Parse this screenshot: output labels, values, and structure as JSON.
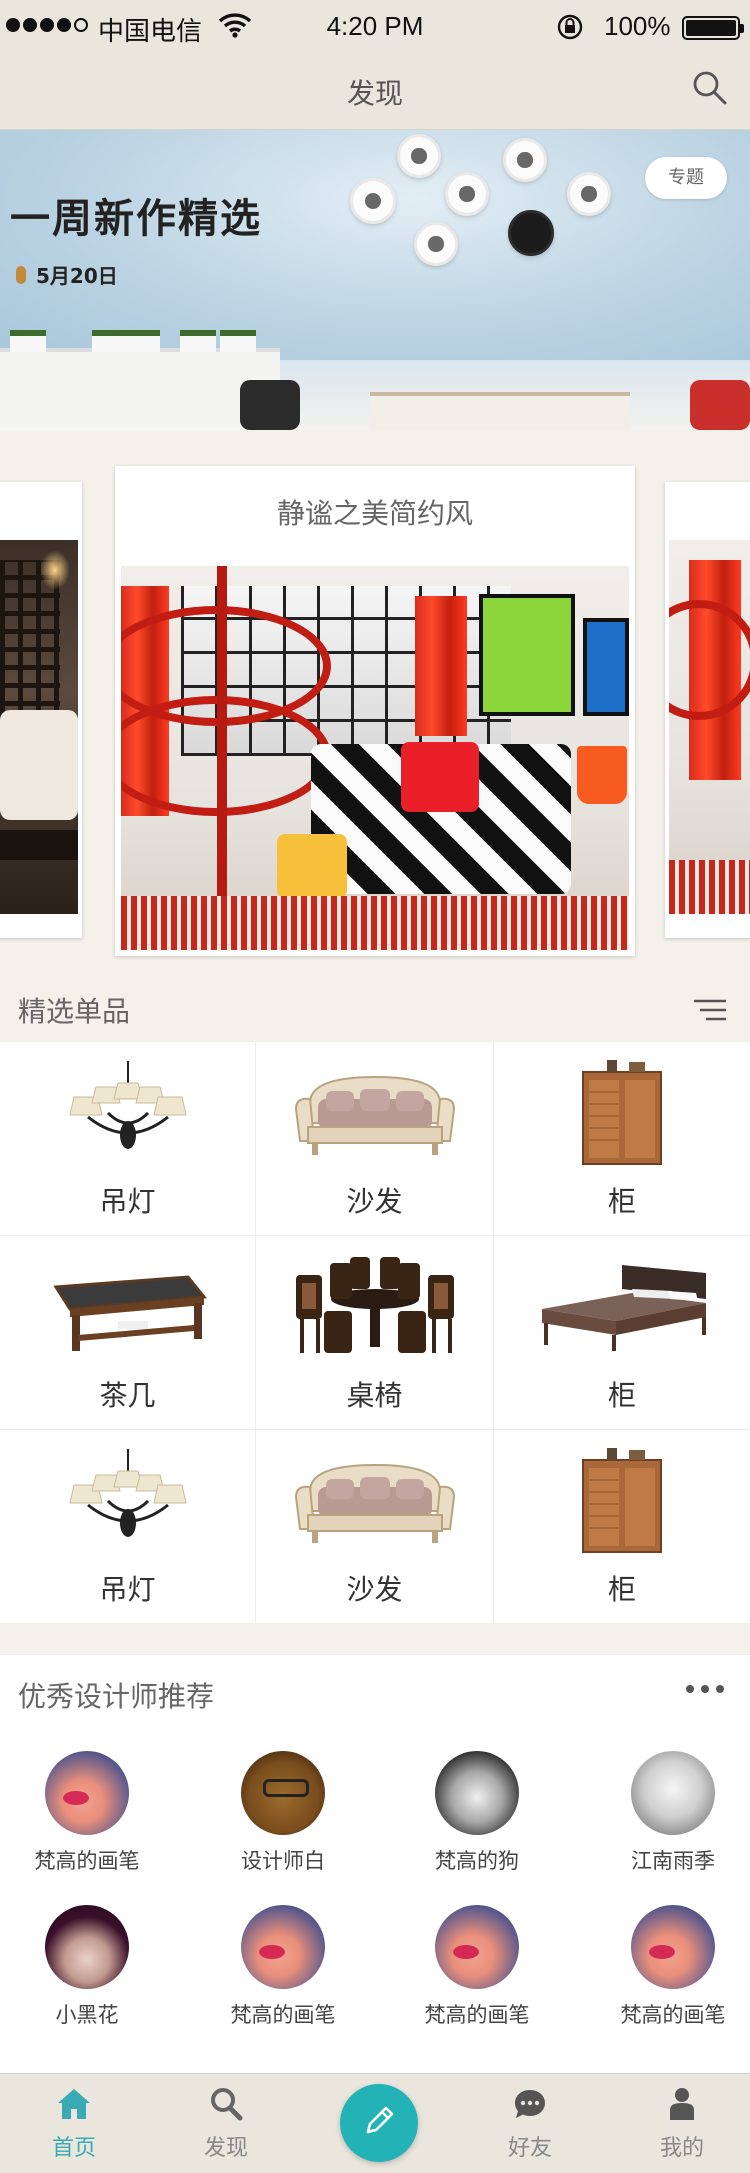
{
  "status_bar": {
    "carrier": "中国电信",
    "time": "4:20 PM",
    "battery": "100%"
  },
  "nav": {
    "title": "发现"
  },
  "banner": {
    "title": "一周新作精选",
    "date": "5月20日",
    "tag": "专题"
  },
  "carousel": {
    "cards": [
      {
        "title": "静谧之美简约风"
      }
    ]
  },
  "featured": {
    "title": "精选单品",
    "items": [
      {
        "label": "吊灯",
        "icon": "chandelier-icon"
      },
      {
        "label": "沙发",
        "icon": "sofa-icon"
      },
      {
        "label": "柜",
        "icon": "cabinet-icon"
      },
      {
        "label": "茶几",
        "icon": "coffee-table-icon"
      },
      {
        "label": "桌椅",
        "icon": "dining-set-icon"
      },
      {
        "label": "柜",
        "icon": "bed-icon"
      },
      {
        "label": "吊灯",
        "icon": "chandelier-icon"
      },
      {
        "label": "沙发",
        "icon": "sofa-icon"
      },
      {
        "label": "柜",
        "icon": "cabinet-icon"
      }
    ]
  },
  "designers": {
    "title": "优秀设计师推荐",
    "people": [
      {
        "name": "梵高的画笔"
      },
      {
        "name": "设计师白"
      },
      {
        "name": "梵高的狗"
      },
      {
        "name": "江南雨季"
      },
      {
        "name": "小黑花"
      },
      {
        "name": "梵高的画笔"
      },
      {
        "name": "梵高的画笔"
      },
      {
        "name": "梵高的画笔"
      }
    ]
  },
  "tabs": [
    {
      "label": "首页",
      "icon": "home-icon",
      "active": true
    },
    {
      "label": "发现",
      "icon": "search-icon",
      "active": false
    },
    {
      "label": "",
      "icon": "pencil-icon",
      "active": false
    },
    {
      "label": "好友",
      "icon": "chat-icon",
      "active": false
    },
    {
      "label": "我的",
      "icon": "user-icon",
      "active": false
    }
  ],
  "colors": {
    "accent": "#23b3b7",
    "active_tab": "#3aaab4",
    "header_bg": "#eae5dd",
    "page_bg": "#f4f1eb"
  }
}
